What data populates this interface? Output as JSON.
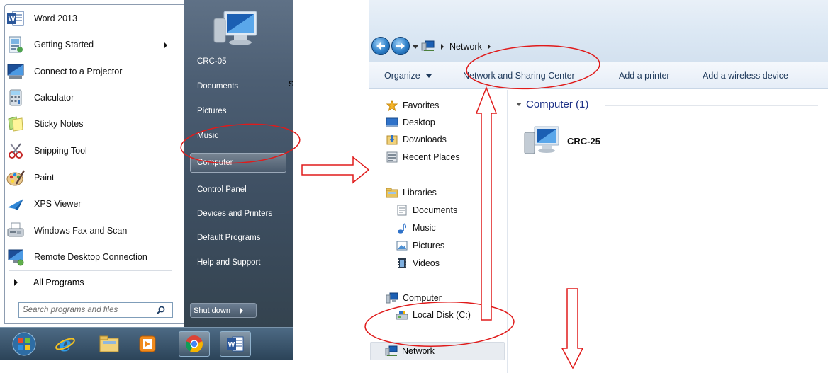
{
  "start_menu": {
    "programs": [
      {
        "label": "Word 2013",
        "icon": "word-icon"
      },
      {
        "label": "Getting Started",
        "icon": "getting-started-icon",
        "has_submenu": true
      },
      {
        "label": "Connect to a Projector",
        "icon": "projector-icon"
      },
      {
        "label": "Calculator",
        "icon": "calculator-icon"
      },
      {
        "label": "Sticky Notes",
        "icon": "sticky-notes-icon"
      },
      {
        "label": "Snipping Tool",
        "icon": "snipping-tool-icon"
      },
      {
        "label": "Paint",
        "icon": "paint-icon"
      },
      {
        "label": "XPS Viewer",
        "icon": "xps-viewer-icon"
      },
      {
        "label": "Windows Fax and Scan",
        "icon": "fax-scan-icon"
      },
      {
        "label": "Remote Desktop Connection",
        "icon": "remote-desktop-icon"
      }
    ],
    "all_programs": "All Programs",
    "search_placeholder": "Search programs and files",
    "right_items": [
      {
        "label": "CRC-05"
      },
      {
        "label": "Documents"
      },
      {
        "label": "Pictures"
      },
      {
        "label": "Music"
      },
      {
        "label": "Computer"
      },
      {
        "label": "Control Panel"
      },
      {
        "label": "Devices and Printers"
      },
      {
        "label": "Default Programs"
      },
      {
        "label": "Help and Support"
      }
    ],
    "shutdown_label": "Shut down",
    "stray_text": "S"
  },
  "taskbar": {
    "items": [
      "start-orb-icon",
      "internet-explorer-icon",
      "file-explorer-icon",
      "media-player-icon",
      "chrome-icon",
      "word-icon"
    ]
  },
  "explorer": {
    "address": {
      "location": "Network"
    },
    "toolbar": {
      "organize": "Organize",
      "network_sharing": "Network and Sharing Center",
      "add_printer": "Add a printer",
      "add_wireless": "Add a wireless device"
    },
    "nav": {
      "favorites": "Favorites",
      "desktop": "Desktop",
      "downloads": "Downloads",
      "recent_places": "Recent Places",
      "libraries": "Libraries",
      "documents": "Documents",
      "music": "Music",
      "pictures": "Pictures",
      "videos": "Videos",
      "computer": "Computer",
      "local_disk": "Local Disk (C:)",
      "network": "Network"
    },
    "group_header": "Computer (1)",
    "items": [
      {
        "label": "CRC-25",
        "icon": "computer-icon"
      }
    ]
  },
  "colors": {
    "annotation_red": "#e01b1b",
    "group_header_blue": "#1e3287"
  }
}
